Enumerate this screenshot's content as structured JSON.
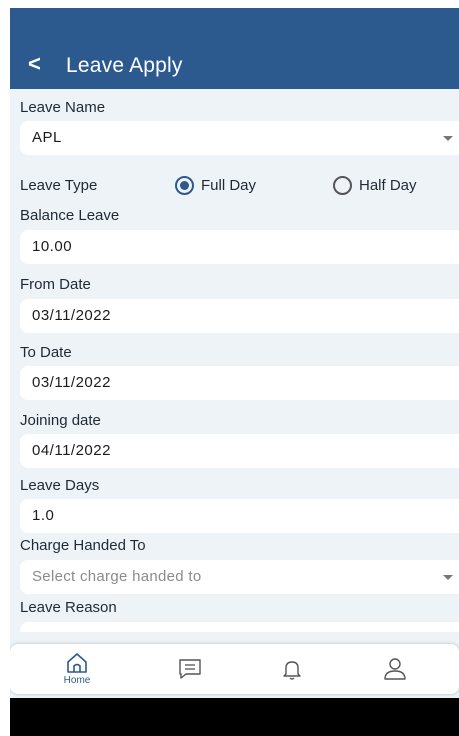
{
  "header": {
    "back_icon": "chevron-left-icon",
    "back_glyph": "<",
    "title": "Leave Apply"
  },
  "form": {
    "leave_name": {
      "label": "Leave Name",
      "value": "APL"
    },
    "leave_type": {
      "label": "Leave Type",
      "options": [
        "Full Day",
        "Half Day"
      ],
      "selected": "Full Day"
    },
    "balance_leave": {
      "label": "Balance Leave",
      "value": "10.00"
    },
    "from_date": {
      "label": "From Date",
      "value": "03/11/2022"
    },
    "to_date": {
      "label": "To Date",
      "value": "03/11/2022"
    },
    "joining_date": {
      "label": "Joining date",
      "value": "04/11/2022"
    },
    "leave_days": {
      "label": "Leave Days",
      "value": "1.0"
    },
    "charge_handed_to": {
      "label": "Charge Handed To",
      "placeholder": "Select charge handed to"
    },
    "leave_reason": {
      "label": "Leave Reason"
    }
  },
  "bottom_nav": {
    "items": [
      {
        "icon": "home-icon",
        "label": "Home"
      },
      {
        "icon": "message-icon"
      },
      {
        "icon": "bell-icon"
      },
      {
        "icon": "user-icon"
      }
    ]
  },
  "colors": {
    "header": "#2c5a8f",
    "background": "#eef3f8",
    "accent": "#2c5a8f"
  }
}
